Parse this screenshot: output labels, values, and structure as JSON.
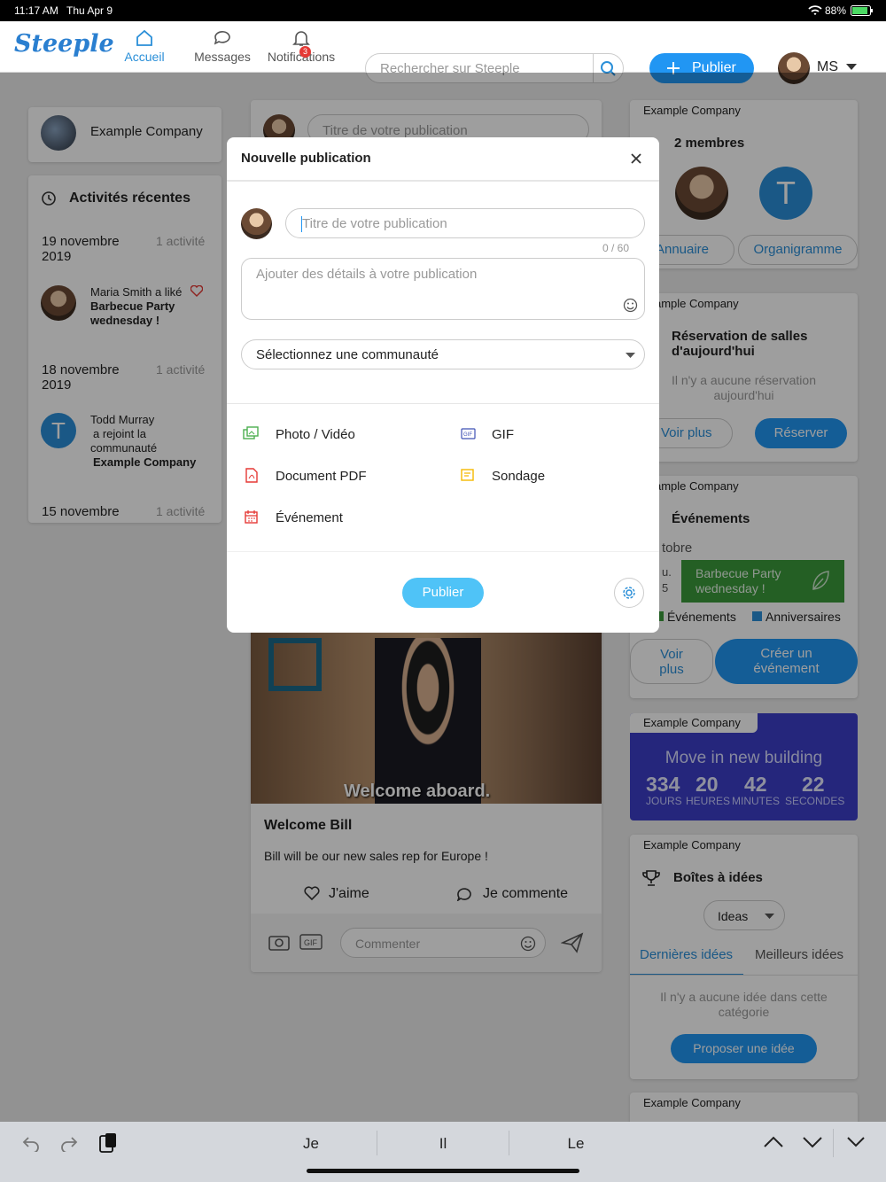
{
  "status": {
    "time": "11:17 AM",
    "date": "Thu Apr 9",
    "battery": "88%"
  },
  "nav": {
    "logo": "Steeple",
    "home": "Accueil",
    "messages": "Messages",
    "notifications": "Notifications",
    "notif_count": "3",
    "search_placeholder": "Rechercher sur Steeple",
    "publish": "Publier",
    "user_initials": "MS"
  },
  "left": {
    "company": "Example Company",
    "recent_title": "Activités récentes",
    "groups": [
      {
        "date": "19 novembre 2019",
        "count": "1 activité",
        "text": "Maria Smith a liké",
        "sub": "Barbecue Party wednesday !"
      },
      {
        "date": "18 novembre 2019",
        "count": "1 activité",
        "l1": "Todd Murray",
        "l2": "a rejoint la",
        "l3": "communauté",
        "l4": "Example Company"
      },
      {
        "date": "15 novembre",
        "count": "1 activité"
      }
    ]
  },
  "feed": {
    "title_placeholder": "Titre de votre publication",
    "gif_caption": "Welcome aboard.",
    "post_title": "Welcome Bill",
    "post_text": "Bill will be our new sales rep for Europe !",
    "like": "J'aime",
    "comment": "Je commente",
    "comment_placeholder": "Commenter"
  },
  "right": {
    "members_company": "Example Company",
    "members_count": "2 membres",
    "annuaire": "Annuaire",
    "organigramme": "Organigramme",
    "rooms_company": "ample Company",
    "rooms_title": "Réservation de salles d'aujourd'hui",
    "rooms_empty": "Il n'y a aucune réservation aujourd'hui",
    "voir_plus": "Voir plus",
    "reserver": "Réserver",
    "events_company": "ample Company",
    "events_title": "Événements",
    "events_month": "tobre",
    "events_day": "u.",
    "events_daynum": "5",
    "event_name": "Barbecue Party wednesday !",
    "legend_events": "Événements",
    "legend_birthdays": "Anniversaires",
    "voir_plus2": "Voir plus",
    "create_event": "Créer un événement",
    "countdown_company": "Example Company",
    "countdown_title": "Move in new building",
    "cd_days": "334",
    "cd_hours": "20",
    "cd_minutes": "42",
    "cd_seconds": "22",
    "cd_l1": "JOURS",
    "cd_l2": "HEURES",
    "cd_l3": "MINUTES",
    "cd_l4": "SECONDES",
    "ideas_company": "Example Company",
    "ideas_title": "Boîtes à idées",
    "ideas_select": "Ideas",
    "tab_latest": "Dernières idées",
    "tab_best": "Meilleurs idées",
    "ideas_empty": "Il n'y a aucune idée dans cette catégorie",
    "propose": "Proposer une idée",
    "last_company": "Example Company"
  },
  "modal": {
    "title": "Nouvelle publication",
    "title_placeholder": "Titre de votre publication",
    "counter": "0 / 60",
    "details_placeholder": "Ajouter des détails à votre publication",
    "community_select": "Sélectionnez une communauté",
    "photo": "Photo / Vidéo",
    "gif": "GIF",
    "pdf": "Document PDF",
    "poll": "Sondage",
    "event": "Événement",
    "publish": "Publier"
  },
  "keyboard": {
    "s1": "Je",
    "s2": "Il",
    "s3": "Le"
  },
  "colors": {
    "accent": "#2196f3",
    "event_green": "#3a9a3a",
    "countdown_bg": "#3c3ec8"
  }
}
